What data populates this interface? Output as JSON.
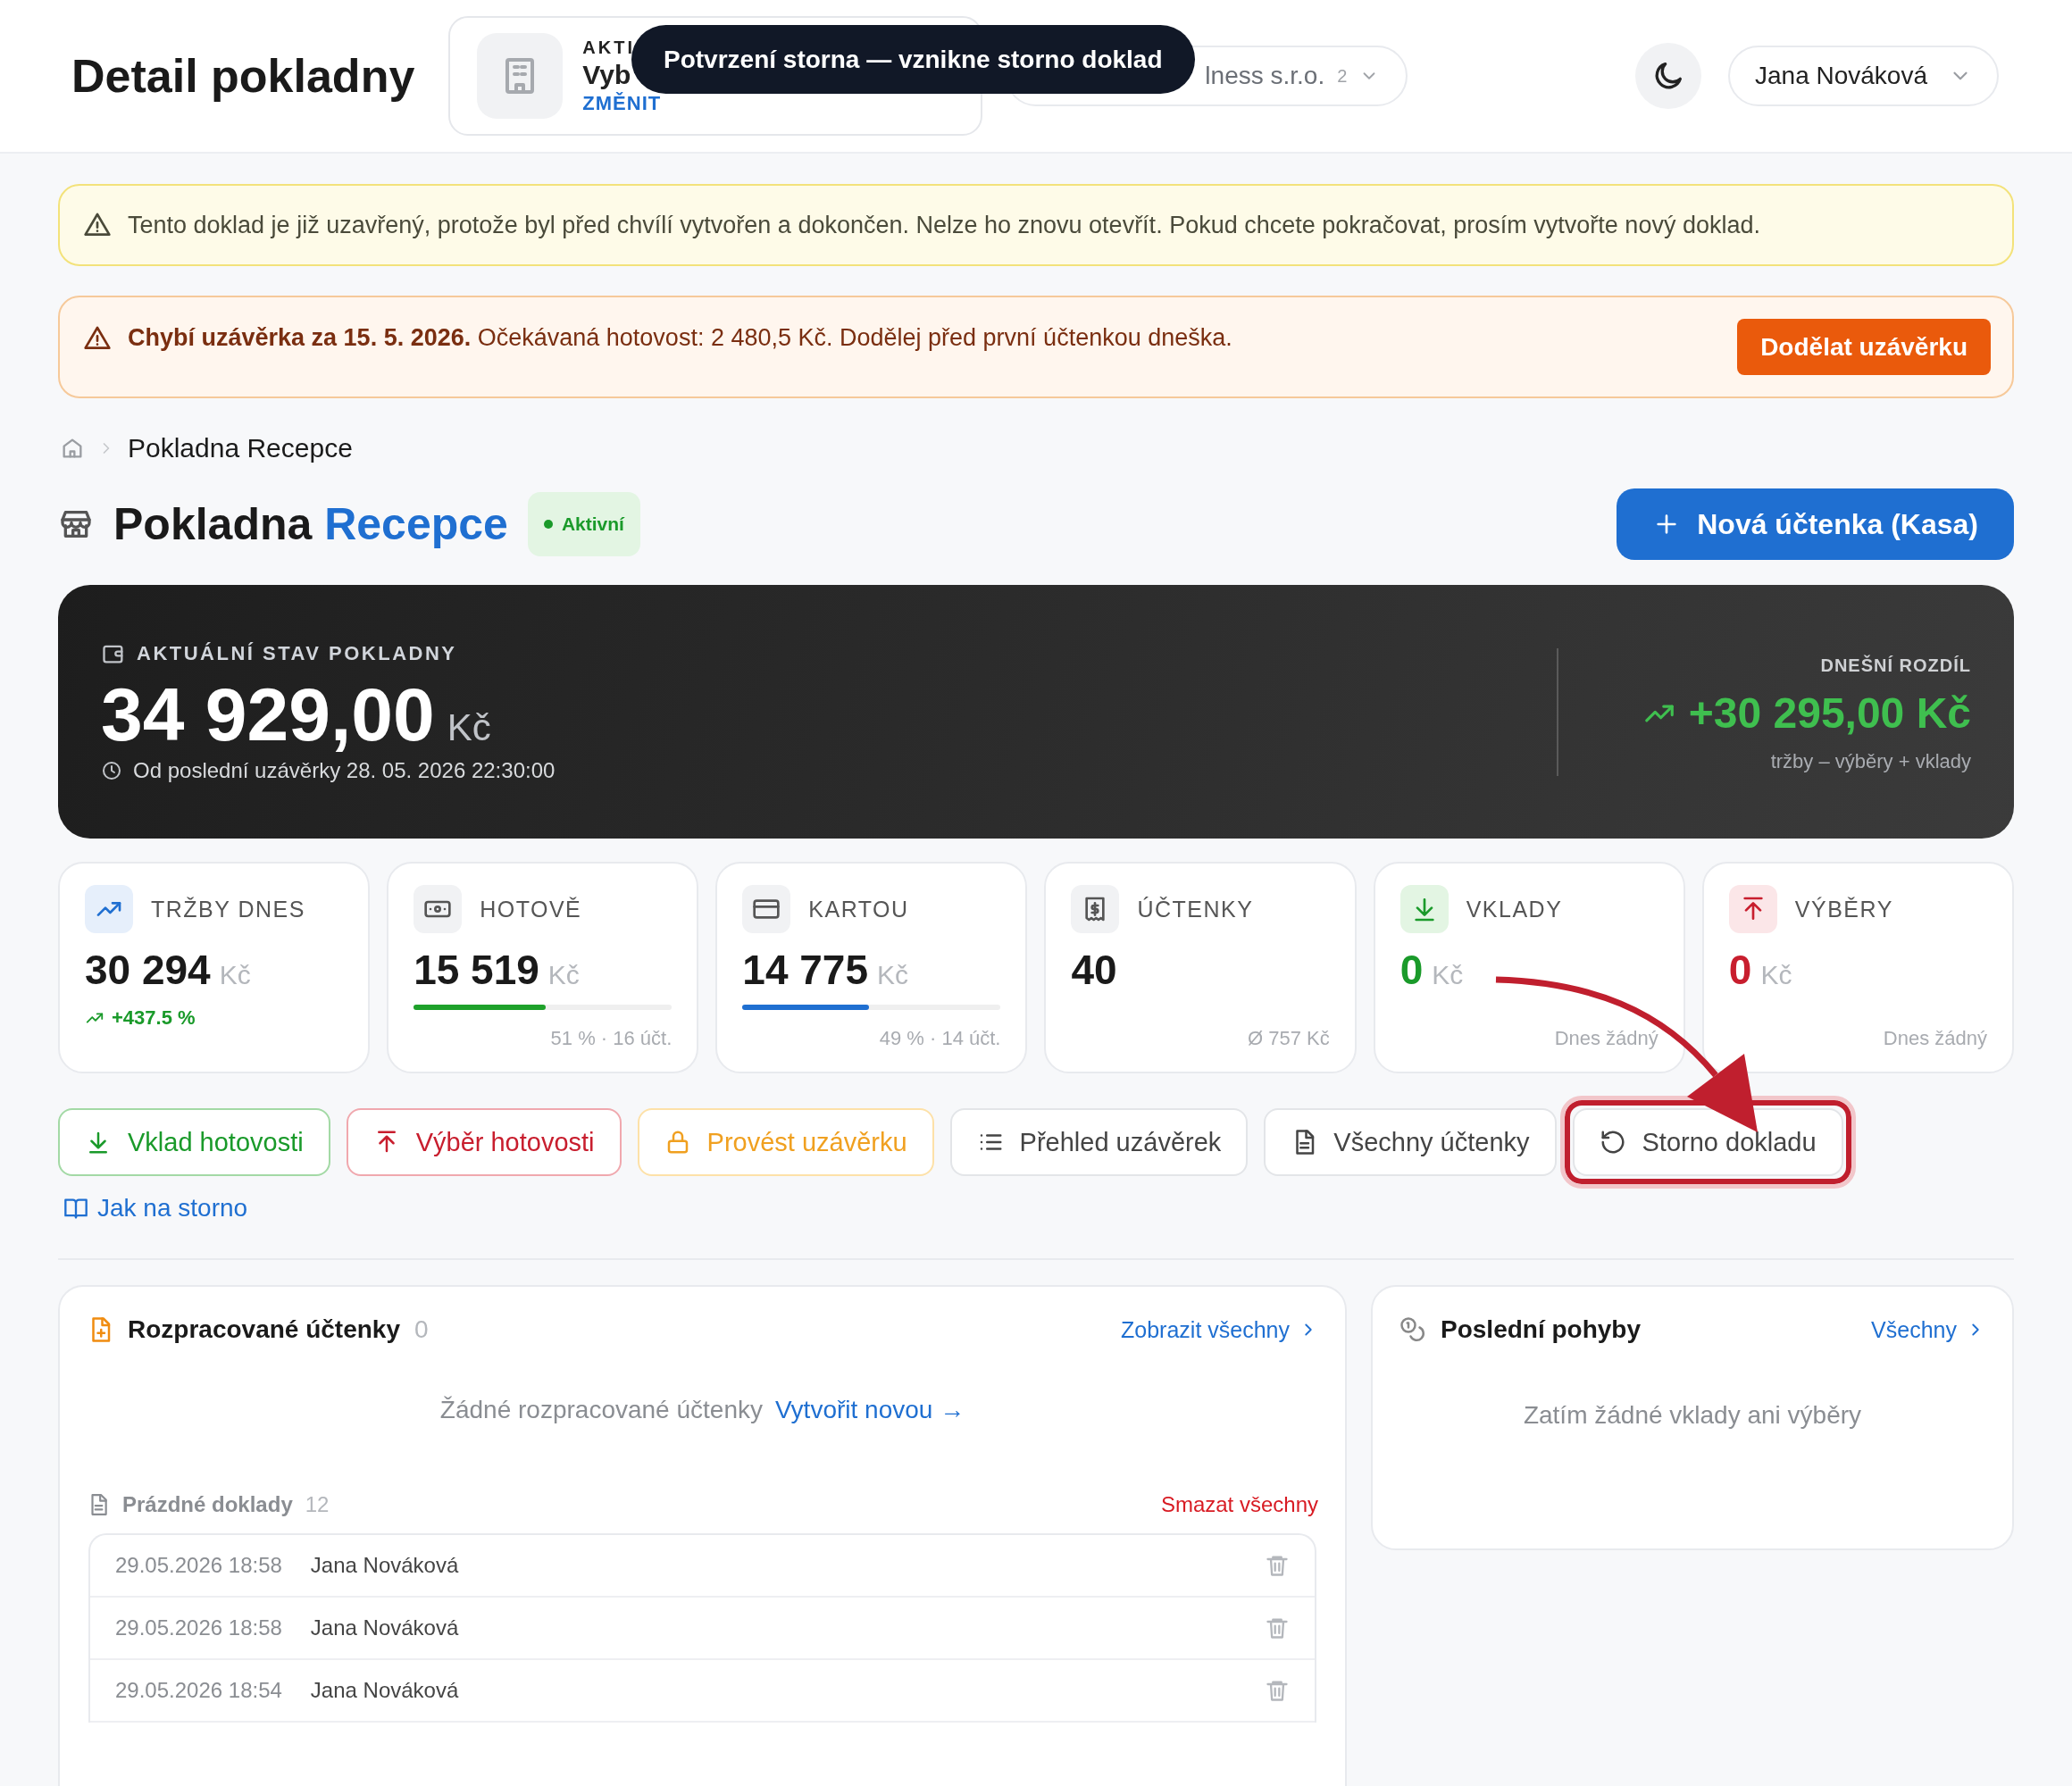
{
  "header": {
    "title": "Detail pokladny",
    "org_switcher": {
      "label": "AKTI",
      "name": "Vyb",
      "action": "ZMĚNIT"
    },
    "tenant_switcher": {
      "name": "lness s.r.o.",
      "count": "2"
    },
    "user": {
      "name": "Jana Nováková"
    }
  },
  "tooltip": {
    "text": "Potvrzení storna — vznikne storno doklad"
  },
  "alerts": [
    {
      "kind": "info",
      "text": "Tento doklad je již uzavřený, protože byl před chvílí vytvořen a dokončen. Nelze ho znovu otevřít. Pokud chcete pokračovat, prosím vytvořte nový doklad."
    },
    {
      "kind": "warning",
      "text": "**Chybí uzávěrka za 15. 5. 2026.** Očekávaná hotovost: 2 480,5 Kč. Dodělej před první účtenkou dneška.",
      "action": "Dodělat uzávěrku"
    }
  ],
  "breadcrumb": {
    "current": "Pokladna Recepce"
  },
  "title": {
    "prefix": "Pokladna",
    "name": "Recepce",
    "status": "Aktivní"
  },
  "primary_action": "Nová účtenka (Kasa)",
  "balance": {
    "label": "AKTUÁLNÍ STAV POKLADNY",
    "amount": "34 929,00",
    "currency": "Kč",
    "since": "Od poslední uzávěrky 28. 05. 2026 22:30:00",
    "diff_label": "DNEŠNÍ ROZDÍL",
    "diff": "+30 295,00 Kč",
    "diff_note": "tržby – výběry + vklady"
  },
  "stats": [
    {
      "kind": "sales",
      "label": "TRŽBY DNES",
      "value": "30 294",
      "currency": "Kč",
      "change": "+437.5 %"
    },
    {
      "kind": "cash",
      "label": "HOTOVĚ",
      "value": "15 519",
      "currency": "Kč",
      "level": 0.51,
      "note": "51 % · 16 účt."
    },
    {
      "kind": "card",
      "label": "KARTOU",
      "value": "14 775",
      "currency": "Kč",
      "level": 0.49,
      "note": "49 % · 14 účt."
    },
    {
      "kind": "count",
      "label": "ÚČTENKY",
      "value": "40",
      "note": "Ø 757 Kč"
    },
    {
      "kind": "deposit",
      "label": "VKLADY",
      "value": "0",
      "currency": "Kč",
      "note": "Dnes žádný"
    },
    {
      "kind": "withdrawal",
      "label": "VÝBĚRY",
      "value": "0",
      "currency": "Kč",
      "note": "Dnes žádný"
    }
  ],
  "actions": [
    {
      "kind": "deposit",
      "label": "Vklad hotovosti",
      "highlighted": false
    },
    {
      "kind": "withdrawal",
      "label": "Výběr hotovosti",
      "highlighted": false
    },
    {
      "kind": "close",
      "label": "Provést uzávěrku",
      "highlighted": false
    },
    {
      "kind": "list",
      "label": "Přehled uzávěrek",
      "highlighted": false
    },
    {
      "kind": "receipts",
      "label": "Všechny účtenky",
      "highlighted": false
    },
    {
      "kind": "storno",
      "label": "Storno dokladu",
      "highlighted": true
    }
  ],
  "help_link": "Jak na storno",
  "drafts": {
    "title": "Rozpracované účtenky",
    "count": "0",
    "link": "Zobrazit všechny",
    "empty": "Žádné rozpracované účtenky",
    "create_link": "Vytvořit novou →",
    "empty_docs": {
      "title": "Prázdné doklady",
      "count": "12",
      "delete_all": "Smazat všechny",
      "rows": [
        {
          "date": "29.05.2026 18:58",
          "user": "Jana Nováková"
        },
        {
          "date": "29.05.2026 18:58",
          "user": "Jana Nováková"
        },
        {
          "date": "29.05.2026 18:54",
          "user": "Jana Nováková"
        }
      ]
    }
  },
  "movements": {
    "title": "Poslední pohyby",
    "link": "Všechny",
    "empty": "Zatím žádné vklady ani výběry"
  }
}
